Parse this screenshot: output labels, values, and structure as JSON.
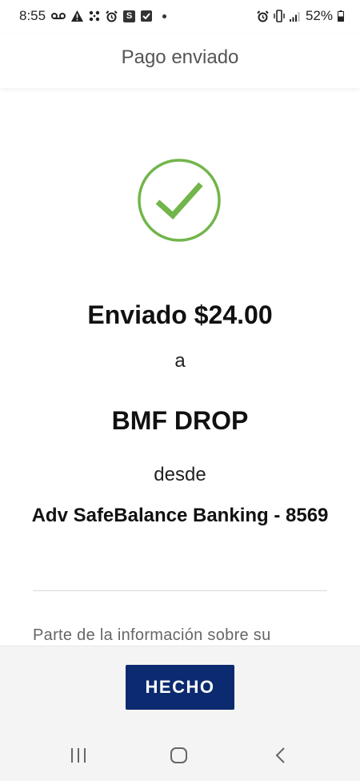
{
  "status_bar": {
    "time": "8:55",
    "s_badge": "S",
    "battery": "52%",
    "left_icons": [
      "voicemail-icon",
      "warning-icon",
      "dots-grid-icon",
      "alarm-icon",
      "s-app-icon",
      "check-box-icon",
      "notification-dot"
    ],
    "right_icons": [
      "alarm-icon",
      "vibrate-icon",
      "signal-icon",
      "battery-icon"
    ]
  },
  "header": {
    "title": "Pago enviado"
  },
  "confirmation": {
    "icon": "check-circle-icon",
    "success_color": "#72b54b",
    "sent_amount": "Enviado $24.00",
    "to_word": "a",
    "recipient": "BMF DROP",
    "from_word": "desde",
    "account": "Adv SafeBalance Banking - 8569",
    "info_text": "Parte de la información sobre su"
  },
  "actions": {
    "done_label": "HECHO",
    "done_color": "#0b2a6f"
  },
  "nav_bar": {
    "icons": [
      "recent-apps-icon",
      "home-icon",
      "back-icon"
    ]
  }
}
